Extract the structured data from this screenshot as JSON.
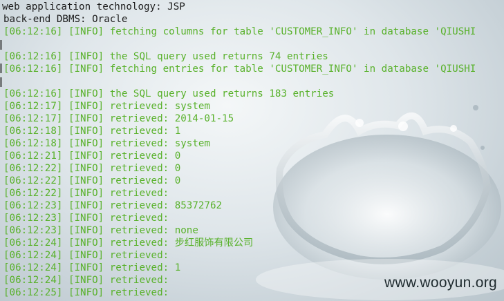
{
  "terminal": {
    "header_lines": [
      "web application technology: JSP",
      "back-end DBMS: Oracle"
    ],
    "log_lines": [
      "[06:12:16] [INFO] fetching columns for table 'CUSTOMER_INFO' in database 'QIUSHI",
      "[06:12:16] [INFO] the SQL query used returns 74 entries",
      "[06:12:16] [INFO] fetching entries for table 'CUSTOMER_INFO' in database 'QIUSHI",
      "[06:12:16] [INFO] the SQL query used returns 183 entries",
      "[06:12:17] [INFO] retrieved: system",
      "[06:12:17] [INFO] retrieved: 2014-01-15",
      "[06:12:18] [INFO] retrieved: 1",
      "[06:12:18] [INFO] retrieved: system",
      "[06:12:21] [INFO] retrieved: 0",
      "[06:12:22] [INFO] retrieved: 0",
      "[06:12:22] [INFO] retrieved: 0",
      "[06:12:22] [INFO] retrieved:",
      "[06:12:23] [INFO] retrieved: 85372762",
      "[06:12:23] [INFO] retrieved:",
      "[06:12:23] [INFO] retrieved: none",
      "[06:12:24] [INFO] retrieved: 步红服饰有限公司",
      "[06:12:24] [INFO] retrieved:",
      "[06:12:24] [INFO] retrieved: 1",
      "[06:12:24] [INFO] retrieved:",
      "[06:12:25] [INFO] retrieved:"
    ]
  },
  "watermark": "www.wooyun.org",
  "colors": {
    "log_text": "#58b12a",
    "header_text": "#1c1c1c"
  }
}
